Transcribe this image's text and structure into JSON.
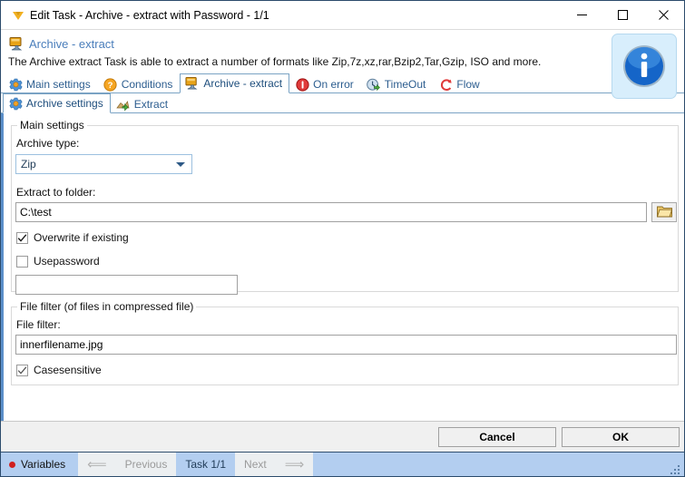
{
  "window": {
    "title": "Edit Task - Archive - extract with Password - 1/1",
    "title_icon": "app-logo-icon",
    "controls": {
      "minimize": "—",
      "maximize": "□",
      "close": "✕"
    }
  },
  "header": {
    "icon": "archive-extract-icon",
    "title": "Archive - extract",
    "description": "The Archive extract Task is able to extract a number of formats like Zip,7z,xz,rar,Bzip2,Tar,Gzip, ISO and more.",
    "info_icon": "info-icon"
  },
  "tabs": [
    {
      "label": "Main settings",
      "icon": "gear-icon",
      "active": false
    },
    {
      "label": "Conditions",
      "icon": "question-circle-icon",
      "active": false
    },
    {
      "label": "Archive - extract",
      "icon": "archive-extract-icon",
      "active": true
    },
    {
      "label": "On error",
      "icon": "error-circle-icon",
      "active": false
    },
    {
      "label": "TimeOut",
      "icon": "timeout-icon",
      "active": false
    },
    {
      "label": "Flow",
      "icon": "flow-icon",
      "active": false
    }
  ],
  "subtabs": [
    {
      "label": "Archive settings",
      "icon": "gear-icon",
      "active": true
    },
    {
      "label": "Extract",
      "icon": "extract-arrow-icon",
      "active": false
    }
  ],
  "main_settings": {
    "caption": "Main settings",
    "archive_type_label": "Archive type:",
    "archive_type_value": "Zip",
    "archive_type_options": [
      "Zip"
    ],
    "extract_to_label": "Extract to folder:",
    "extract_to_value": "C:\\test",
    "browse_icon": "folder-icon",
    "overwrite_label": "Overwrite if existing",
    "overwrite_checked": true,
    "usepassword_label": "Usepassword",
    "usepassword_checked": false,
    "password_value": "",
    "password_placeholder": ""
  },
  "file_filter": {
    "caption": "File filter (of files in compressed file)",
    "filter_label": "File filter:",
    "filter_value": "innerfilename.jpg",
    "casesensitive_label": "Casesensitive",
    "casesensitive_checked": true
  },
  "footer": {
    "cancel_label": "Cancel",
    "ok_label": "OK"
  },
  "statusbar": {
    "variables_label": "Variables",
    "variables_dot": "red-dot-icon",
    "previous_label": "Previous",
    "task_label": "Task 1/1",
    "next_label": "Next",
    "prev_arrow": "arrow-left-icon",
    "next_arrow": "arrow-right-icon",
    "grip": "resize-grip-icon"
  },
  "colors": {
    "accent_blue": "#5b8fc9",
    "tab_text": "#2c5d8f",
    "statusbar": "#b3cef0",
    "link": "#4a7ebb"
  }
}
